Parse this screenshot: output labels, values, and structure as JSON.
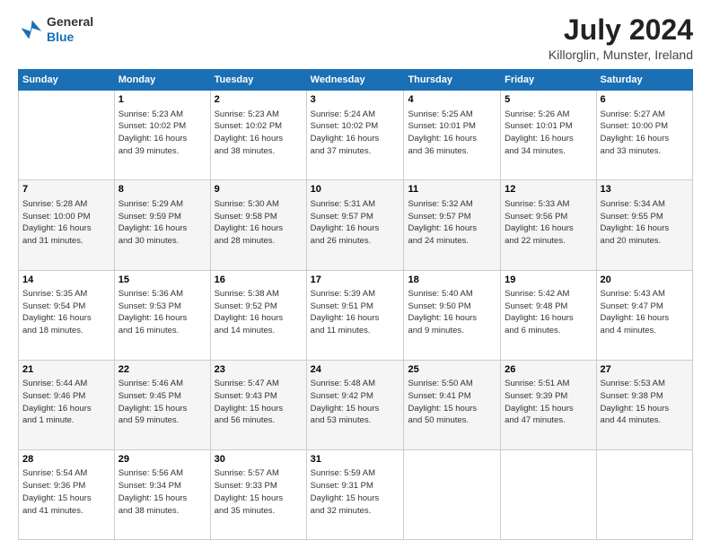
{
  "header": {
    "logo": {
      "line1": "General",
      "line2": "Blue"
    },
    "title": "July 2024",
    "location": "Killorglin, Munster, Ireland"
  },
  "calendar": {
    "headers": [
      "Sunday",
      "Monday",
      "Tuesday",
      "Wednesday",
      "Thursday",
      "Friday",
      "Saturday"
    ],
    "weeks": [
      [
        {
          "day": "",
          "info": ""
        },
        {
          "day": "1",
          "info": "Sunrise: 5:23 AM\nSunset: 10:02 PM\nDaylight: 16 hours\nand 39 minutes."
        },
        {
          "day": "2",
          "info": "Sunrise: 5:23 AM\nSunset: 10:02 PM\nDaylight: 16 hours\nand 38 minutes."
        },
        {
          "day": "3",
          "info": "Sunrise: 5:24 AM\nSunset: 10:02 PM\nDaylight: 16 hours\nand 37 minutes."
        },
        {
          "day": "4",
          "info": "Sunrise: 5:25 AM\nSunset: 10:01 PM\nDaylight: 16 hours\nand 36 minutes."
        },
        {
          "day": "5",
          "info": "Sunrise: 5:26 AM\nSunset: 10:01 PM\nDaylight: 16 hours\nand 34 minutes."
        },
        {
          "day": "6",
          "info": "Sunrise: 5:27 AM\nSunset: 10:00 PM\nDaylight: 16 hours\nand 33 minutes."
        }
      ],
      [
        {
          "day": "7",
          "info": "Sunrise: 5:28 AM\nSunset: 10:00 PM\nDaylight: 16 hours\nand 31 minutes."
        },
        {
          "day": "8",
          "info": "Sunrise: 5:29 AM\nSunset: 9:59 PM\nDaylight: 16 hours\nand 30 minutes."
        },
        {
          "day": "9",
          "info": "Sunrise: 5:30 AM\nSunset: 9:58 PM\nDaylight: 16 hours\nand 28 minutes."
        },
        {
          "day": "10",
          "info": "Sunrise: 5:31 AM\nSunset: 9:57 PM\nDaylight: 16 hours\nand 26 minutes."
        },
        {
          "day": "11",
          "info": "Sunrise: 5:32 AM\nSunset: 9:57 PM\nDaylight: 16 hours\nand 24 minutes."
        },
        {
          "day": "12",
          "info": "Sunrise: 5:33 AM\nSunset: 9:56 PM\nDaylight: 16 hours\nand 22 minutes."
        },
        {
          "day": "13",
          "info": "Sunrise: 5:34 AM\nSunset: 9:55 PM\nDaylight: 16 hours\nand 20 minutes."
        }
      ],
      [
        {
          "day": "14",
          "info": "Sunrise: 5:35 AM\nSunset: 9:54 PM\nDaylight: 16 hours\nand 18 minutes."
        },
        {
          "day": "15",
          "info": "Sunrise: 5:36 AM\nSunset: 9:53 PM\nDaylight: 16 hours\nand 16 minutes."
        },
        {
          "day": "16",
          "info": "Sunrise: 5:38 AM\nSunset: 9:52 PM\nDaylight: 16 hours\nand 14 minutes."
        },
        {
          "day": "17",
          "info": "Sunrise: 5:39 AM\nSunset: 9:51 PM\nDaylight: 16 hours\nand 11 minutes."
        },
        {
          "day": "18",
          "info": "Sunrise: 5:40 AM\nSunset: 9:50 PM\nDaylight: 16 hours\nand 9 minutes."
        },
        {
          "day": "19",
          "info": "Sunrise: 5:42 AM\nSunset: 9:48 PM\nDaylight: 16 hours\nand 6 minutes."
        },
        {
          "day": "20",
          "info": "Sunrise: 5:43 AM\nSunset: 9:47 PM\nDaylight: 16 hours\nand 4 minutes."
        }
      ],
      [
        {
          "day": "21",
          "info": "Sunrise: 5:44 AM\nSunset: 9:46 PM\nDaylight: 16 hours\nand 1 minute."
        },
        {
          "day": "22",
          "info": "Sunrise: 5:46 AM\nSunset: 9:45 PM\nDaylight: 15 hours\nand 59 minutes."
        },
        {
          "day": "23",
          "info": "Sunrise: 5:47 AM\nSunset: 9:43 PM\nDaylight: 15 hours\nand 56 minutes."
        },
        {
          "day": "24",
          "info": "Sunrise: 5:48 AM\nSunset: 9:42 PM\nDaylight: 15 hours\nand 53 minutes."
        },
        {
          "day": "25",
          "info": "Sunrise: 5:50 AM\nSunset: 9:41 PM\nDaylight: 15 hours\nand 50 minutes."
        },
        {
          "day": "26",
          "info": "Sunrise: 5:51 AM\nSunset: 9:39 PM\nDaylight: 15 hours\nand 47 minutes."
        },
        {
          "day": "27",
          "info": "Sunrise: 5:53 AM\nSunset: 9:38 PM\nDaylight: 15 hours\nand 44 minutes."
        }
      ],
      [
        {
          "day": "28",
          "info": "Sunrise: 5:54 AM\nSunset: 9:36 PM\nDaylight: 15 hours\nand 41 minutes."
        },
        {
          "day": "29",
          "info": "Sunrise: 5:56 AM\nSunset: 9:34 PM\nDaylight: 15 hours\nand 38 minutes."
        },
        {
          "day": "30",
          "info": "Sunrise: 5:57 AM\nSunset: 9:33 PM\nDaylight: 15 hours\nand 35 minutes."
        },
        {
          "day": "31",
          "info": "Sunrise: 5:59 AM\nSunset: 9:31 PM\nDaylight: 15 hours\nand 32 minutes."
        },
        {
          "day": "",
          "info": ""
        },
        {
          "day": "",
          "info": ""
        },
        {
          "day": "",
          "info": ""
        }
      ]
    ]
  }
}
